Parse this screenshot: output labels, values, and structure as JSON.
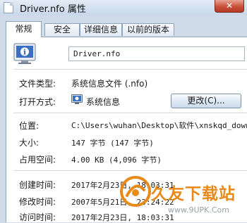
{
  "window": {
    "title": "Driver.nfo 属性",
    "close_label": "✕"
  },
  "tabs": [
    {
      "label": "常规",
      "active": true
    },
    {
      "label": "安全",
      "active": false
    },
    {
      "label": "详细信息",
      "active": false
    },
    {
      "label": "以前的版本",
      "active": false
    }
  ],
  "file": {
    "name": "Driver.nfo",
    "icon": "system-info-file-icon"
  },
  "properties": {
    "type_label": "文件类型:",
    "type_value": "系统信息文件 (.nfo)",
    "opens_label": "打开方式:",
    "opens_value": "系统信息",
    "change_button": "更改(C)...",
    "location_label": "位置:",
    "location_value": "C:\\Users\\wuhan\\Desktop\\软件\\xnskqd_downcc",
    "size_label": "大小:",
    "size_value": "147 字节 (147 字节)",
    "disk_label": "占用空间:",
    "disk_value": "4.00 KB (4,096 字节)",
    "created_label": "创建时间:",
    "created_value": "2017年2月23日, 18:03:31",
    "modified_label": "修改时间:",
    "modified_value": "2007年5月21日, 23:24:22",
    "accessed_label": "访问时间:",
    "accessed_value": "2017年2月23日, 18:03:31"
  },
  "watermark": {
    "text": "久友下载站",
    "url": "www.9UPK.Com"
  },
  "colors": {
    "window_frame": "#cfdbe8",
    "accent": "#e8891a",
    "close": "#c7503a"
  }
}
